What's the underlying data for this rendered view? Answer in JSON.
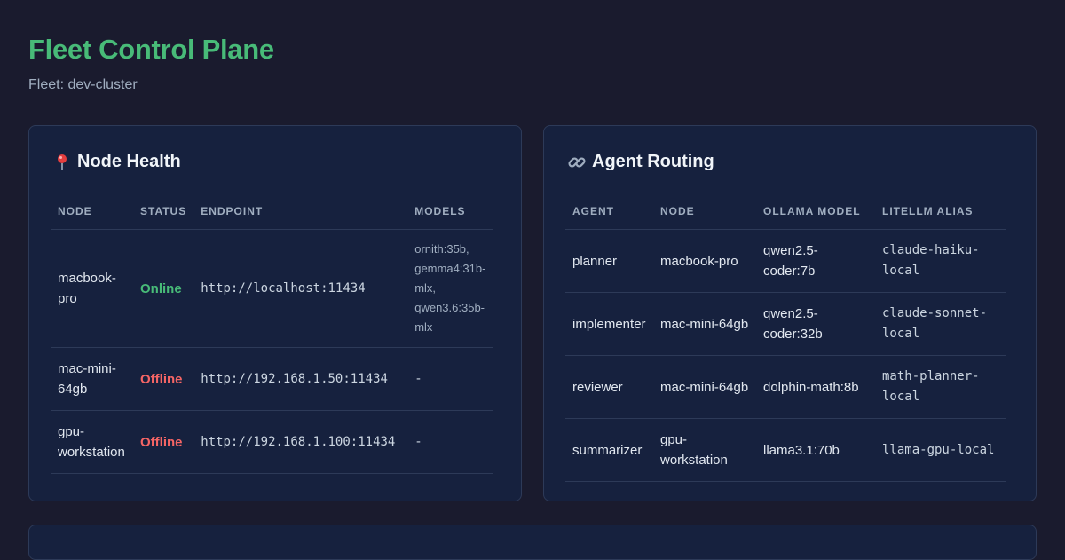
{
  "header": {
    "title": "Fleet Control Plane",
    "subtitle": "Fleet: dev-cluster"
  },
  "node_health": {
    "icon": "pushpin-icon",
    "title": "Node Health",
    "columns": [
      "NODE",
      "STATUS",
      "ENDPOINT",
      "MODELS"
    ],
    "rows": [
      {
        "node": "macbook-pro",
        "status": "Online",
        "endpoint": "http://localhost:11434",
        "models": "ornith:35b, gemma4:31b-mlx, qwen3.6:35b-mlx"
      },
      {
        "node": "mac-mini-64gb",
        "status": "Offline",
        "endpoint": "http://192.168.1.50:11434",
        "models": "-"
      },
      {
        "node": "gpu-workstation",
        "status": "Offline",
        "endpoint": "http://192.168.1.100:11434",
        "models": "-"
      }
    ]
  },
  "agent_routing": {
    "icon": "link-icon",
    "title": "Agent Routing",
    "columns": [
      "AGENT",
      "NODE",
      "OLLAMA MODEL",
      "LITELLM ALIAS"
    ],
    "rows": [
      {
        "agent": "planner",
        "node": "macbook-pro",
        "model": "qwen2.5-coder:7b",
        "alias": "claude-haiku-local"
      },
      {
        "agent": "implementer",
        "node": "mac-mini-64gb",
        "model": "qwen2.5-coder:32b",
        "alias": "claude-sonnet-local"
      },
      {
        "agent": "reviewer",
        "node": "mac-mini-64gb",
        "model": "dolphin-math:8b",
        "alias": "math-planner-local"
      },
      {
        "agent": "summarizer",
        "node": "gpu-workstation",
        "model": "llama3.1:70b",
        "alias": "llama-gpu-local"
      }
    ]
  },
  "colors": {
    "background": "#1a1b2e",
    "panel": "#16213e",
    "accent": "#48bb78",
    "online": "#48bb78",
    "offline": "#f56565"
  }
}
